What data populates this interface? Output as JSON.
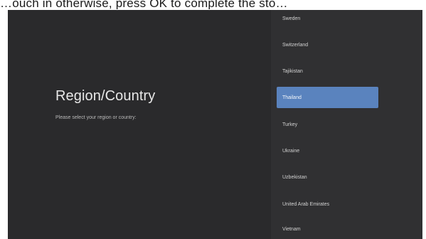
{
  "caption": "…ouch in otherwise, press OK to complete the sto…",
  "region_screen": {
    "title": "Region/Country",
    "subtitle": "Please select your region or country:"
  },
  "country_list": {
    "selected": "Thailand",
    "items": [
      {
        "label": "Sweden"
      },
      {
        "label": "Switzerland"
      },
      {
        "label": "Tajikistan"
      },
      {
        "label": "Thailand"
      },
      {
        "label": "Turkey"
      },
      {
        "label": "Ukraine"
      },
      {
        "label": "Uzbekistan"
      },
      {
        "label": "United Arab Emirates"
      },
      {
        "label": "Vietnam"
      }
    ]
  },
  "colors": {
    "screen_background": "#2a2a2c",
    "list_background": "#303032",
    "selection_highlight": "#5a83be"
  }
}
